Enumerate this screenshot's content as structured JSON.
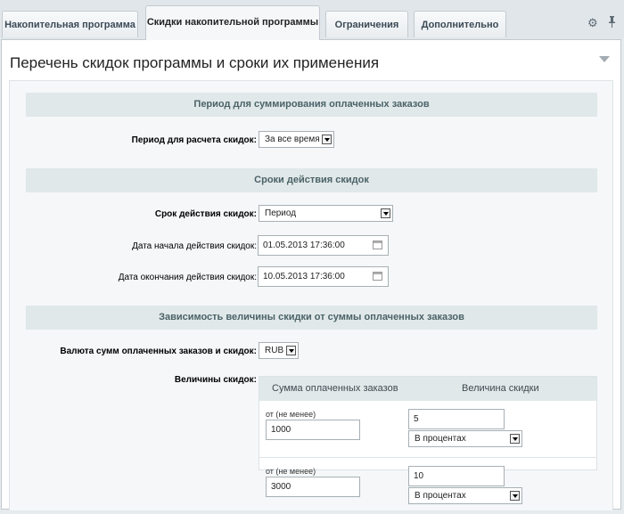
{
  "tabs": [
    {
      "label": "Накопительная программа"
    },
    {
      "label": "Скидки накопительной программы"
    },
    {
      "label": "Ограничения"
    },
    {
      "label": "Дополнительно"
    }
  ],
  "tools": {
    "gear": "⚙",
    "pin": "📌"
  },
  "main": {
    "title": "Перечень скидок программы и сроки их применения",
    "sections": [
      {
        "title": "Период для суммирования оплаченных заказов"
      },
      {
        "title": "Сроки действия скидок"
      },
      {
        "title": "Зависимость величины скидки от суммы оплаченных заказов"
      }
    ]
  },
  "period": {
    "label": "Период для расчета скидок:",
    "value": "За все время"
  },
  "validity": {
    "label": "Срок действия скидок:",
    "value": "Период",
    "start_label": "Дата начала действия скидок:",
    "start_value": "01.05.2013 17:36:00",
    "end_label": "Дата окончания действия скидок:",
    "end_value": "10.05.2013 17:36:00"
  },
  "currency": {
    "label": "Валюта сумм оплаченных заказов и скидок:",
    "value": "RUB"
  },
  "amounts": {
    "label": "Величины скидок:",
    "col_sum": "Сумма оплаченных заказов",
    "col_discount": "Величина скидки",
    "rows": [
      {
        "min_label": "от (не менее)",
        "min_value": "1000",
        "discount": "5",
        "type": "В процентах"
      },
      {
        "min_label": "от (не менее)",
        "min_value": "3000",
        "discount": "10",
        "type": "В процентах"
      }
    ]
  }
}
